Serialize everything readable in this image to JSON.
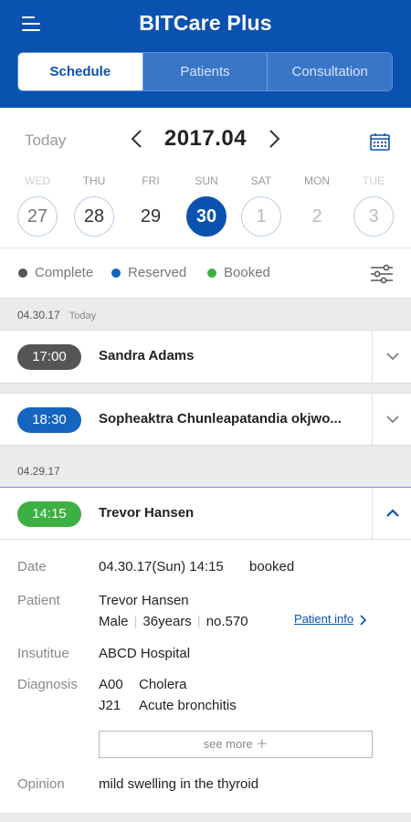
{
  "app": {
    "title": "BITCare Plus"
  },
  "tabs": [
    {
      "label": "Schedule",
      "active": true
    },
    {
      "label": "Patients",
      "active": false
    },
    {
      "label": "Consultation",
      "active": false
    }
  ],
  "monthbar": {
    "today_label": "Today",
    "month": "2017.04"
  },
  "days": [
    {
      "dow": "WED",
      "num": "27"
    },
    {
      "dow": "THU",
      "num": "28"
    },
    {
      "dow": "FRI",
      "num": "29"
    },
    {
      "dow": "SUN",
      "num": "30"
    },
    {
      "dow": "SAT",
      "num": "1"
    },
    {
      "dow": "MON",
      "num": "2"
    },
    {
      "dow": "TUE",
      "num": "3"
    }
  ],
  "legend": [
    {
      "label": "Complete",
      "color": "#555555"
    },
    {
      "label": "Reserved",
      "color": "#1565c0"
    },
    {
      "label": "Booked",
      "color": "#3cb043"
    }
  ],
  "sections": [
    {
      "date": "04.30.17",
      "sub": "Today"
    },
    {
      "date": "04.29.17",
      "sub": ""
    }
  ],
  "appointments": [
    {
      "time": "17:00",
      "name": "Sandra Adams",
      "color": "#555555"
    },
    {
      "time": "18:30",
      "name": "Sopheaktra Chunleapatandia okjwo...",
      "color": "#1565c0"
    },
    {
      "time": "14:15",
      "name": "Trevor Hansen",
      "color": "#3cb043"
    }
  ],
  "detail": {
    "date_label": "Date",
    "date_value": "04.30.17(Sun) 14:15",
    "status": "booked",
    "patient_label": "Patient",
    "patient_name": "Trevor Hansen",
    "patient_sex": "Male",
    "patient_age": "36years",
    "patient_no": "no.570",
    "patient_info_link": "Patient info",
    "institute_label": "Insutitue",
    "institute_value": "ABCD Hospital",
    "diagnosis_label": "Diagnosis",
    "diagnoses": [
      {
        "code": "A00",
        "desc": "Cholera"
      },
      {
        "code": "J21",
        "desc": "Acute bronchitis"
      }
    ],
    "see_more": "see more ＋",
    "opinion_label": "Opinion",
    "opinion_value": "mild swelling in the thyroid"
  }
}
